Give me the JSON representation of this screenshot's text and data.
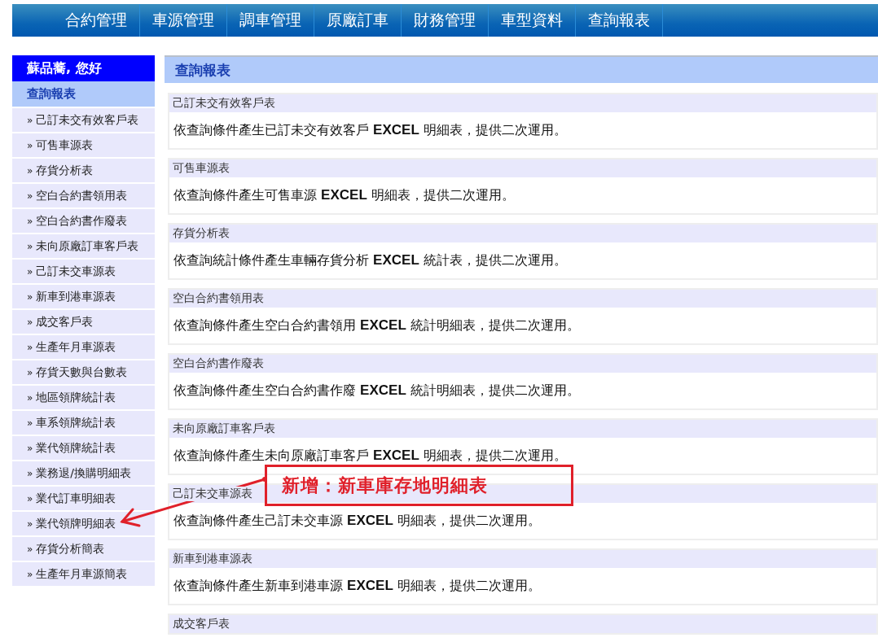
{
  "nav": {
    "items": [
      "合約管理",
      "車源管理",
      "調車管理",
      "原廠訂車",
      "財務管理",
      "車型資料",
      "查詢報表"
    ]
  },
  "sidebar": {
    "greeting": "蘇品蕎, 您好",
    "section": "查詢報表",
    "items": [
      {
        "bullet": "»",
        "label": "己訂未交有效客戶表"
      },
      {
        "bullet": "»",
        "label": "可售車源表"
      },
      {
        "bullet": "»",
        "label": "存貨分析表"
      },
      {
        "bullet": "»",
        "label": "空白合約書領用表"
      },
      {
        "bullet": "»",
        "label": "空白合約書作廢表"
      },
      {
        "bullet": "»",
        "label": "未向原廠訂車客戶表"
      },
      {
        "bullet": "»",
        "label": "己訂未交車源表"
      },
      {
        "bullet": "»",
        "label": "新車到港車源表"
      },
      {
        "bullet": "»",
        "label": "成交客戶表"
      },
      {
        "bullet": "»",
        "label": "生產年月車源表"
      },
      {
        "bullet": "»",
        "label": "存貨天數與台數表"
      },
      {
        "bullet": "»",
        "label": "地區領牌統計表"
      },
      {
        "bullet": "»",
        "label": "車系領牌統計表"
      },
      {
        "bullet": "»",
        "label": "業代領牌統計表"
      },
      {
        "bullet": "»",
        "label": "業務退/換購明細表"
      },
      {
        "bullet": "»",
        "label": "業代訂車明細表"
      },
      {
        "bullet": "»",
        "label": "業代領牌明細表"
      },
      {
        "bullet": "»",
        "label": "存貨分析簡表"
      },
      {
        "bullet": "»",
        "label": "生產年月車源簡表"
      }
    ]
  },
  "main": {
    "title": "查詢報表",
    "reports": [
      {
        "title": "己訂未交有效客戶表",
        "description": "依查詢條件產生已訂未交有效客戶 **EXCEL** 明細表，提供二次運用。"
      },
      {
        "title": "可售車源表",
        "description": "依查詢條件產生可售車源 **EXCEL** 明細表，提供二次運用。"
      },
      {
        "title": "存貨分析表",
        "description": "依查詢統計條件產生車輛存貨分析 **EXCEL** 統計表，提供二次運用。"
      },
      {
        "title": "空白合約書領用表",
        "description": "依查詢條件產生空白合約書領用 **EXCEL** 統計明細表，提供二次運用。"
      },
      {
        "title": "空白合約書作廢表",
        "description": "依查詢條件產生空白合約書作廢 **EXCEL** 統計明細表，提供二次運用。"
      },
      {
        "title": "未向原廠訂車客戶表",
        "description": "依查詢條件產生未向原廠訂車客戶 **EXCEL** 明細表，提供二次運用。"
      },
      {
        "title": "己訂未交車源表",
        "description": "依查詢條件產生己訂未交車源 **EXCEL** 明細表，提供二次運用。"
      },
      {
        "title": "新車到港車源表",
        "description": "依查詢條件產生新車到港車源 **EXCEL** 明細表，提供二次運用。"
      },
      {
        "title": "成交客戶表"
      }
    ]
  },
  "annotation": {
    "text": "新增：新車庫存地明細表"
  }
}
